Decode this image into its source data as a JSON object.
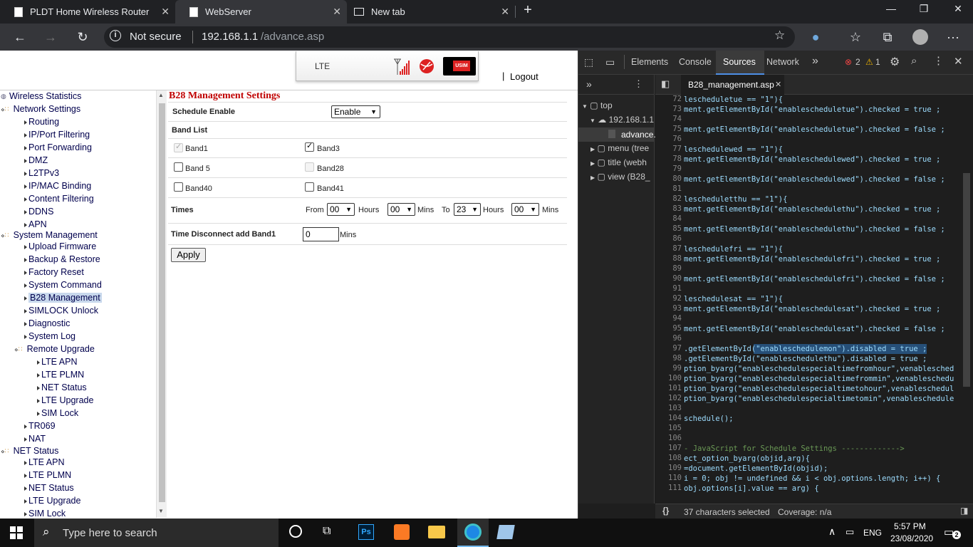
{
  "tabs": [
    {
      "title": "PLDT Home Wireless Router"
    },
    {
      "title": "WebServer"
    },
    {
      "title": "New tab"
    }
  ],
  "address": {
    "security": "Not secure",
    "host": "192.168.1.1",
    "path": "/advance.asp"
  },
  "header": {
    "lte_label": "LTE",
    "usim_label": "USIM",
    "logout_label": "Logout"
  },
  "tree": {
    "items": [
      {
        "label": "Wireless Statistics"
      },
      {
        "label": "Network Settings"
      },
      {
        "label": "Routing"
      },
      {
        "label": "IP/Port Filtering"
      },
      {
        "label": "Port Forwarding"
      },
      {
        "label": "DMZ"
      },
      {
        "label": "L2TPv3"
      },
      {
        "label": "IP/MAC Binding"
      },
      {
        "label": "Content Filtering"
      },
      {
        "label": "DDNS"
      },
      {
        "label": "APN"
      },
      {
        "label": "System Management"
      },
      {
        "label": "Upload Firmware"
      },
      {
        "label": "Backup & Restore"
      },
      {
        "label": "Factory Reset"
      },
      {
        "label": "System Command"
      },
      {
        "label": "B28 Management"
      },
      {
        "label": "SIMLOCK Unlock"
      },
      {
        "label": "Diagnostic"
      },
      {
        "label": "System Log"
      },
      {
        "label": "Remote Upgrade"
      },
      {
        "label": "LTE APN"
      },
      {
        "label": "LTE PLMN"
      },
      {
        "label": "NET Status"
      },
      {
        "label": "LTE Upgrade"
      },
      {
        "label": "SIM Lock"
      },
      {
        "label": "TR069"
      },
      {
        "label": "NAT"
      },
      {
        "label": "NET Status"
      },
      {
        "label": "LTE APN"
      },
      {
        "label": "LTE PLMN"
      },
      {
        "label": "NET Status"
      },
      {
        "label": "LTE Upgrade"
      },
      {
        "label": "SIM Lock"
      }
    ]
  },
  "form": {
    "title": "B28 Management Settings",
    "schedule_enable_label": "Schedule Enable",
    "schedule_enable_value": "Enable",
    "band_list_label": "Band List",
    "bands": [
      {
        "label": "Band1",
        "checked": true,
        "disabled": true
      },
      {
        "label": "Band3",
        "checked": true,
        "disabled": false
      },
      {
        "label": "Band 5",
        "checked": false,
        "disabled": false
      },
      {
        "label": "Band28",
        "checked": false,
        "disabled": true
      },
      {
        "label": "Band40",
        "checked": false,
        "disabled": false
      },
      {
        "label": "Band41",
        "checked": false,
        "disabled": false
      }
    ],
    "times_label": "Times",
    "from_label": "From",
    "from_hours": "00",
    "hours_label": "Hours",
    "from_mins": "00",
    "mins_label": "Mins",
    "to_label": "To",
    "to_hours": "23",
    "to_mins": "00",
    "disconnect_label": "Time Disconnect add Band1",
    "disconnect_value": "0",
    "disconnect_unit": "Mins",
    "apply_label": "Apply"
  },
  "devtools": {
    "tabs": [
      "Elements",
      "Console",
      "Sources",
      "Network"
    ],
    "active_tab": "Sources",
    "errors": "2",
    "warnings": "1",
    "file_tab": "B28_management.asp",
    "nav": {
      "top": "top",
      "host": "192.168.1.1",
      "file": "advance.",
      "items": [
        "menu (tree",
        "title (webh",
        "view (B28_"
      ]
    },
    "code_lines": [
      {
        "n": "72",
        "t": "lescheduletue == \"1\"){"
      },
      {
        "n": "73",
        "t": "ment.getElementById(\"enablescheduletue\").checked = true ;"
      },
      {
        "n": "74",
        "t": ""
      },
      {
        "n": "75",
        "t": "ment.getElementById(\"enablescheduletue\").checked = false ;"
      },
      {
        "n": "76",
        "t": ""
      },
      {
        "n": "77",
        "t": "leschedulewed == \"1\"){"
      },
      {
        "n": "78",
        "t": "ment.getElementById(\"enableschedulewed\").checked = true ;"
      },
      {
        "n": "79",
        "t": ""
      },
      {
        "n": "80",
        "t": "ment.getElementById(\"enableschedulewed\").checked = false ;"
      },
      {
        "n": "81",
        "t": ""
      },
      {
        "n": "82",
        "t": "lescheduletthu == \"1\"){"
      },
      {
        "n": "83",
        "t": "ment.getElementById(\"enableschedulethu\").checked = true ;"
      },
      {
        "n": "84",
        "t": ""
      },
      {
        "n": "85",
        "t": "ment.getElementById(\"enableschedulethu\").checked = false ;"
      },
      {
        "n": "86",
        "t": ""
      },
      {
        "n": "87",
        "t": "leschedulefri == \"1\"){"
      },
      {
        "n": "88",
        "t": "ment.getElementById(\"enableschedulefri\").checked = true ;"
      },
      {
        "n": "89",
        "t": ""
      },
      {
        "n": "90",
        "t": "ment.getElementById(\"enableschedulefri\").checked = false ;"
      },
      {
        "n": "91",
        "t": ""
      },
      {
        "n": "92",
        "t": "leschedulesat == \"1\"){"
      },
      {
        "n": "93",
        "t": "ment.getElementById(\"enableschedulesat\").checked = true ;"
      },
      {
        "n": "94",
        "t": ""
      },
      {
        "n": "95",
        "t": "ment.getElementById(\"enableschedulesat\").checked = false ;"
      },
      {
        "n": "96",
        "t": ""
      },
      {
        "n": "97",
        "t": ".getElementById(\"enableschedulemon\").disabled = true ;"
      },
      {
        "n": "98",
        "t": ".getElementById(\"enableschedulethu\").disabled = true ;"
      },
      {
        "n": "99",
        "t": "ption_byarg(\"enableschedulespecialtimefromhour\",venablesched"
      },
      {
        "n": "100",
        "t": "ption_byarg(\"enableschedulespecialtimefrommin\",venableschedu"
      },
      {
        "n": "101",
        "t": "ption_byarg(\"enableschedulespecialtimetohour\",venableschedul"
      },
      {
        "n": "102",
        "t": "ption_byarg(\"enableschedulespecialtimetomin\",venableschedule"
      },
      {
        "n": "103",
        "t": ""
      },
      {
        "n": "104",
        "t": "schedule();"
      },
      {
        "n": "105",
        "t": ""
      },
      {
        "n": "106",
        "t": ""
      },
      {
        "n": "107",
        "t": "- JavaScript for Schedule Settings ------------->"
      },
      {
        "n": "108",
        "t": "ect_option_byarg(objid,arg){"
      },
      {
        "n": "109",
        "t": "=document.getElementById(objid);"
      },
      {
        "n": "110",
        "t": "i = 0; obj != undefined && i < obj.options.length; i++) {"
      },
      {
        "n": "111",
        "t": "obj.options[i].value == arg) {"
      }
    ],
    "status": "37 characters selected",
    "coverage": "Coverage: n/a"
  },
  "taskbar": {
    "search_placeholder": "Type here to search",
    "lang": "ENG",
    "time": "5:57 PM",
    "date": "23/08/2020",
    "notifications": "2"
  }
}
